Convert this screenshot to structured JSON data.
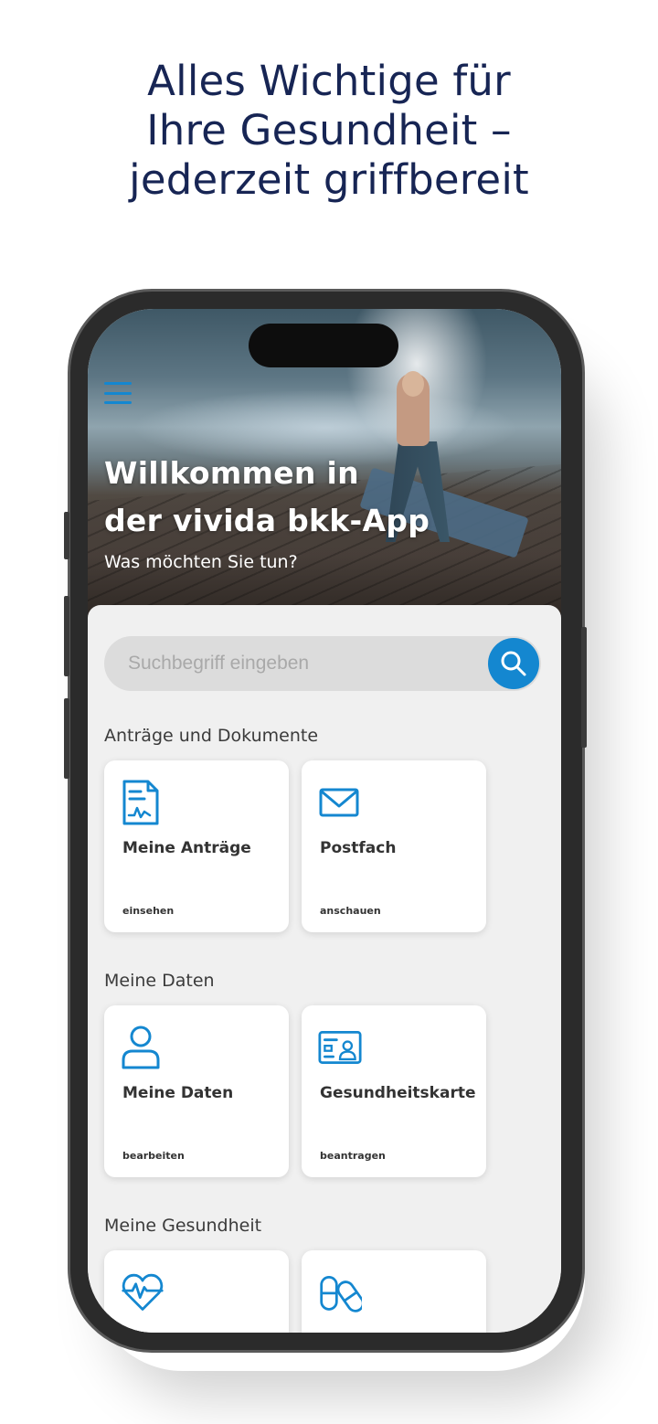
{
  "headline": {
    "line1": "Alles Wichtige für",
    "line2": "Ihre Gesundheit –",
    "line3": "jederzeit griffbereit"
  },
  "hero": {
    "title_line1": "Willkommen in",
    "title_line2": "der vivida bkk-App",
    "subtitle": "Was möchten Sie tun?"
  },
  "search": {
    "placeholder": "Suchbegriff eingeben"
  },
  "sections": [
    {
      "title": "Anträge und Dokumente",
      "cards": [
        {
          "title": "Meine Anträge",
          "action": "einsehen",
          "icon": "document-icon"
        },
        {
          "title": "Postfach",
          "action": "anschauen",
          "icon": "envelope-icon"
        }
      ]
    },
    {
      "title": "Meine Daten",
      "cards": [
        {
          "title": "Meine Daten",
          "action": "bearbeiten",
          "icon": "user-icon"
        },
        {
          "title": "Gesundheitskarte",
          "action": "beantragen",
          "icon": "id-card-icon"
        }
      ]
    },
    {
      "title": "Meine Gesundheit",
      "cards": [
        {
          "title": "",
          "action": "",
          "icon": "heart-pulse-icon"
        },
        {
          "title": "",
          "action": "",
          "icon": "pills-icon"
        }
      ]
    }
  ],
  "colors": {
    "accent": "#1487d0",
    "headline": "#172554",
    "background": "#f0f0f0"
  }
}
